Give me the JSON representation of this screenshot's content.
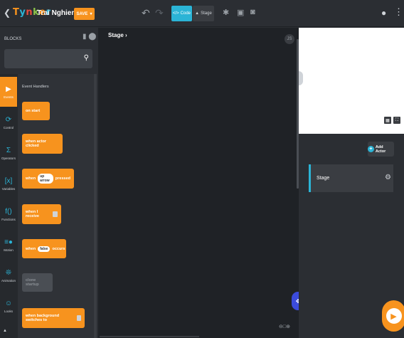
{
  "header": {
    "logo": "Tynker",
    "project_name": "Trai Nghiem",
    "save_label": "SAVE",
    "code_tab": "Code",
    "stage_tab": "Stage"
  },
  "blocks_panel": {
    "title": "BLOCKS",
    "search_placeholder": ""
  },
  "categories": [
    {
      "label": "Events",
      "icon": "play-icon",
      "active": true
    },
    {
      "label": "Control",
      "icon": "loop-icon"
    },
    {
      "label": "Operators",
      "icon": "sigma-icon"
    },
    {
      "label": "Variables",
      "icon": "variable-icon"
    },
    {
      "label": "Functions",
      "icon": "function-icon"
    },
    {
      "label": "Motion",
      "icon": "motion-icon"
    },
    {
      "label": "Animation",
      "icon": "animation-icon"
    },
    {
      "label": "Looks",
      "icon": "looks-icon"
    }
  ],
  "palette": {
    "section": "Event Handlers",
    "blocks": [
      {
        "text": "on start"
      },
      {
        "text": "when actor clicked"
      },
      {
        "prefix": "when",
        "pill": "up arrow",
        "suffix": "pressed"
      },
      {
        "text": "when I receive"
      },
      {
        "prefix": "when",
        "pill": "false",
        "suffix": "occurs"
      },
      {
        "text": "clone startup"
      },
      {
        "text": "when background switches to"
      }
    ]
  },
  "workspace": {
    "breadcrumb": "Stage",
    "js_label": "JS"
  },
  "right": {
    "add_actor": "Add Actor",
    "stage_item": "Stage"
  },
  "colors": {
    "accent": "#f7931e",
    "tab_active": "#2bb4d6"
  }
}
